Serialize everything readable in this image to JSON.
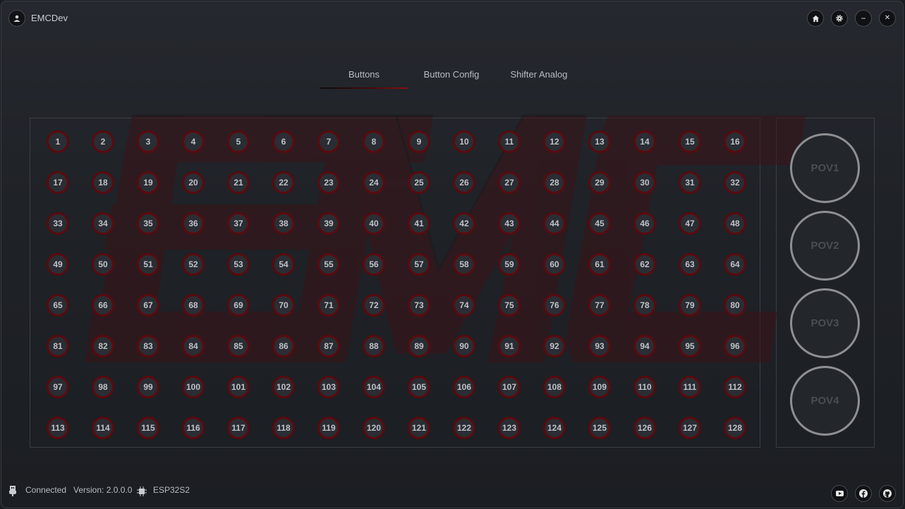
{
  "app": {
    "title": "EMCDev"
  },
  "window_controls": [
    {
      "name": "home-button",
      "icon": "home-icon"
    },
    {
      "name": "settings-button",
      "icon": "gear-icon"
    },
    {
      "name": "minimize-button",
      "icon": "minimize-icon",
      "glyph": "−"
    },
    {
      "name": "close-button",
      "icon": "close-icon",
      "glyph": "✕"
    }
  ],
  "tabs": [
    {
      "label": "Buttons",
      "active": true
    },
    {
      "label": "Button Config",
      "active": false
    },
    {
      "label": "Shifter Analog",
      "active": false
    }
  ],
  "buttons": [
    "1",
    "2",
    "3",
    "4",
    "5",
    "6",
    "7",
    "8",
    "9",
    "10",
    "11",
    "12",
    "13",
    "14",
    "15",
    "16",
    "17",
    "18",
    "19",
    "20",
    "21",
    "22",
    "23",
    "24",
    "25",
    "26",
    "27",
    "28",
    "29",
    "30",
    "31",
    "32",
    "33",
    "34",
    "35",
    "36",
    "37",
    "38",
    "39",
    "40",
    "41",
    "42",
    "43",
    "44",
    "45",
    "46",
    "47",
    "48",
    "49",
    "50",
    "51",
    "52",
    "53",
    "54",
    "55",
    "56",
    "57",
    "58",
    "59",
    "60",
    "61",
    "62",
    "63",
    "64",
    "65",
    "66",
    "67",
    "68",
    "69",
    "70",
    "71",
    "72",
    "73",
    "74",
    "75",
    "76",
    "77",
    "78",
    "79",
    "80",
    "81",
    "82",
    "83",
    "84",
    "85",
    "86",
    "87",
    "88",
    "89",
    "90",
    "91",
    "92",
    "93",
    "94",
    "95",
    "96",
    "97",
    "98",
    "99",
    "100",
    "101",
    "102",
    "103",
    "104",
    "105",
    "106",
    "107",
    "108",
    "109",
    "110",
    "111",
    "112",
    "113",
    "114",
    "115",
    "116",
    "117",
    "118",
    "119",
    "120",
    "121",
    "122",
    "123",
    "124",
    "125",
    "126",
    "127",
    "128"
  ],
  "povs": [
    "POV1",
    "POV2",
    "POV3",
    "POV4"
  ],
  "status": {
    "connection": "Connected",
    "version": "Version: 2.0.0.0",
    "board": "ESP32S2"
  },
  "social": [
    {
      "name": "youtube-button",
      "icon": "youtube-icon"
    },
    {
      "name": "facebook-button",
      "icon": "facebook-icon"
    },
    {
      "name": "github-button",
      "icon": "github-icon"
    }
  ],
  "colors": {
    "accent": "#8a0f0f",
    "button_ring": "#5a0a0e",
    "pov_ring": "#8d8f93",
    "background": "#1f2227"
  }
}
